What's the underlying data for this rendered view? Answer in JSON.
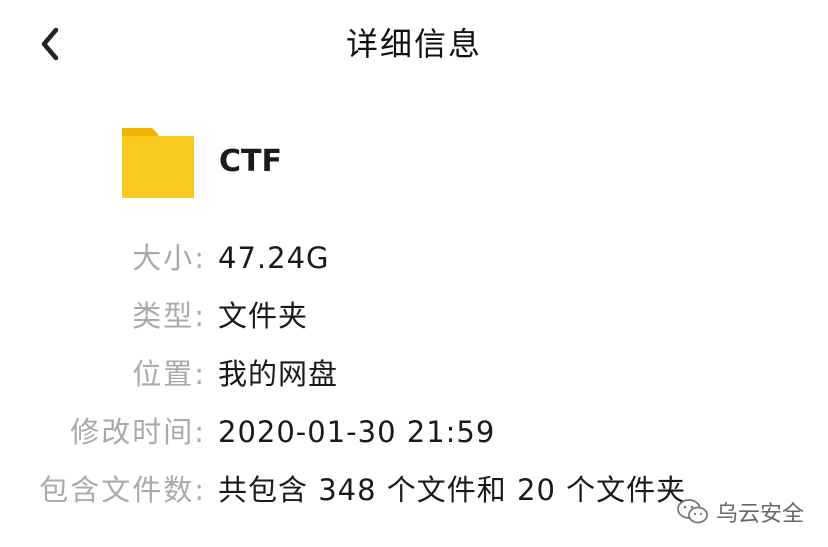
{
  "header": {
    "title": "详细信息",
    "back_icon": "chevron-left-icon"
  },
  "file": {
    "name": "CTF",
    "icon": "folder-icon",
    "icon_color": "#F9C91E"
  },
  "details": [
    {
      "label": "大小:",
      "value": "47.24G"
    },
    {
      "label": "类型:",
      "value": "文件夹"
    },
    {
      "label": "位置:",
      "value": "我的网盘"
    },
    {
      "label": "修改时间:",
      "value": "2020-01-30 21:59"
    },
    {
      "label": "包含文件数:",
      "value": "共包含 348 个文件和 20 个文件夹"
    }
  ],
  "watermark": {
    "text": "乌云安全",
    "icon": "wechat-icon"
  }
}
